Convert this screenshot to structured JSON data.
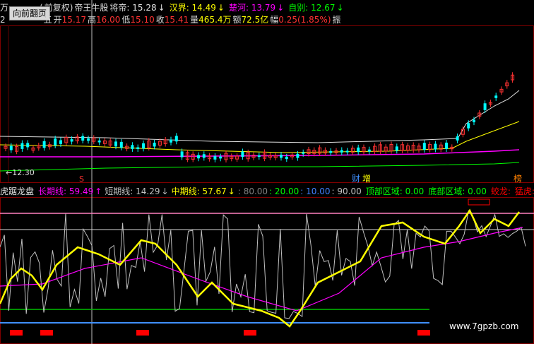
{
  "header": {
    "row1": [
      {
        "text": "万",
        "color": "#d8d8d8"
      },
      {
        "text": "(",
        "color": "#d8d8d8"
      },
      {
        "text": "前复权)",
        "color": "#d8d8d8"
      },
      {
        "text": "帝王牛股",
        "color": "#e0e0e0"
      },
      {
        "text": "将帝: 15.28",
        "color": "#e0e0e0"
      },
      {
        "text": "↓",
        "color": "#e0e0e0"
      },
      {
        "text": "汉界: 14.49",
        "color": "#ffff00"
      },
      {
        "text": "↓",
        "color": "#ffff00"
      },
      {
        "text": "楚河: 13.79",
        "color": "#ff00ff"
      },
      {
        "text": "↓",
        "color": "#ff00ff"
      },
      {
        "text": "自别: 12.67",
        "color": "#00ff00"
      },
      {
        "text": "↓",
        "color": "#00ff00"
      }
    ],
    "row2_prefix": "2",
    "weekday": "五",
    "open_label": "开",
    "open_value": "15.17",
    "high_label": "高",
    "high_value": "16.00",
    "low_label": "低",
    "low_value": "15.10",
    "close_label": "收",
    "close_value": "15.41",
    "volume_label": "量",
    "volume_value": "465.4万",
    "amount_label": "额",
    "amount_value": "72.5亿",
    "change_label": "幅",
    "change_value": "0.25(1.85%)",
    "amplitude_label": "振"
  },
  "back_button": "向前翻页",
  "price_panel": {
    "low_marker": "←12.30",
    "event_s": "S",
    "tag_cai": "财",
    "tag_zeng": "增",
    "tag_bang": "榜",
    "colors": {
      "up": "#ff3232",
      "down": "#00ffff",
      "white_ma": "#e0e0e0",
      "yellow_ma": "#ffff00",
      "magenta_ma": "#ff00ff",
      "green_ma": "#00ff00"
    }
  },
  "indicator_header": {
    "name": "虎踞龙盘",
    "long_label": "长期线: 59.49",
    "long_arrow": "↑",
    "short_label": "短期线: 14.29",
    "short_arrow": "↓",
    "mid_label": "中期线: 57.67",
    "mid_arrow": "↓",
    "lvl80": ": 80.00",
    "lvl20": ": 20.00",
    "lvl10": ": 10.00",
    "lvl90": ": 90.00",
    "top_zone": "顶部区域: 0.00",
    "bottom_zone": "底部区域: 0.00",
    "snake": "蛟龙:",
    "tiger": "猛虎:",
    "colors": {
      "long": "#ff00ff",
      "short": "#c0c0c0",
      "mid": "#ffff00",
      "lvl80": "#808080",
      "lvl20": "#00ff00",
      "lvl10": "#4080ff",
      "lvl90": "#c0c0c0",
      "top": "#00ff00",
      "bottom": "#00ff00",
      "snake": "#ff0000",
      "tiger": "#ff0000"
    }
  },
  "watermark": "www.7gpzb.com"
}
